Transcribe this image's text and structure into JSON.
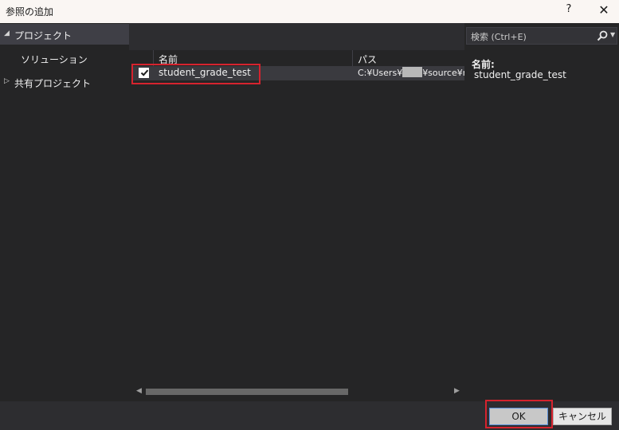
{
  "window": {
    "title": "参照の追加",
    "help": "?",
    "close": "✕"
  },
  "sidebar": {
    "items": [
      {
        "label": "プロジェクト",
        "arrow": "◢"
      },
      {
        "label": "ソリューション"
      },
      {
        "label": "共有プロジェクト",
        "arrow": "▷"
      }
    ]
  },
  "grid": {
    "columns": {
      "name": "名前",
      "path": "パス"
    },
    "rows": [
      {
        "checked": true,
        "name": "student_grade_test",
        "path_before": "C:¥Users¥",
        "path_after": "¥source¥repos¥"
      }
    ]
  },
  "search": {
    "placeholder": "検索 (Ctrl+E)"
  },
  "properties": {
    "name_label": "名前:",
    "name_value": "student_grade_test"
  },
  "buttons": {
    "ok": "OK",
    "cancel": "キャンセル"
  },
  "colors": {
    "highlight": "#d6232e",
    "dialog_bg": "#252526",
    "selection": "#3f3f46"
  }
}
